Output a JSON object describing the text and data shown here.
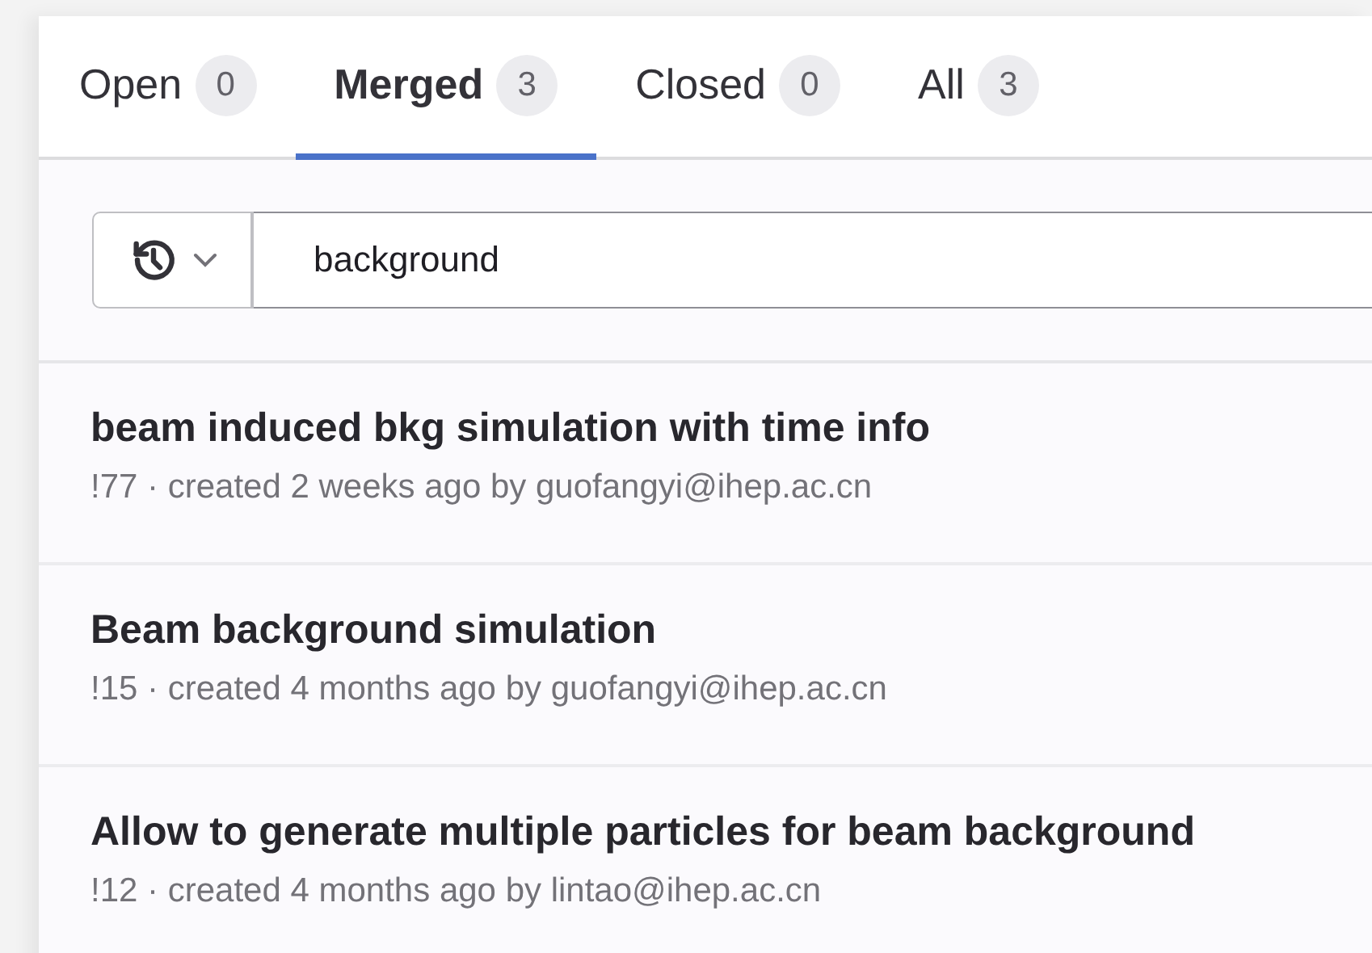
{
  "tabs": [
    {
      "label": "Open",
      "count": "0",
      "selected": false
    },
    {
      "label": "Merged",
      "count": "3",
      "selected": true
    },
    {
      "label": "Closed",
      "count": "0",
      "selected": false
    },
    {
      "label": "All",
      "count": "3",
      "selected": false
    }
  ],
  "search": {
    "value": "background"
  },
  "merge_requests": [
    {
      "title": "beam induced bkg simulation with time info",
      "meta": "!77 · created 2 weeks ago by guofangyi@ihep.ac.cn"
    },
    {
      "title": "Beam background simulation",
      "meta": "!15 · created 4 months ago by guofangyi@ihep.ac.cn"
    },
    {
      "title": "Allow to generate multiple particles for beam background",
      "meta": "!12 · created 4 months ago by lintao@ihep.ac.cn"
    }
  ]
}
